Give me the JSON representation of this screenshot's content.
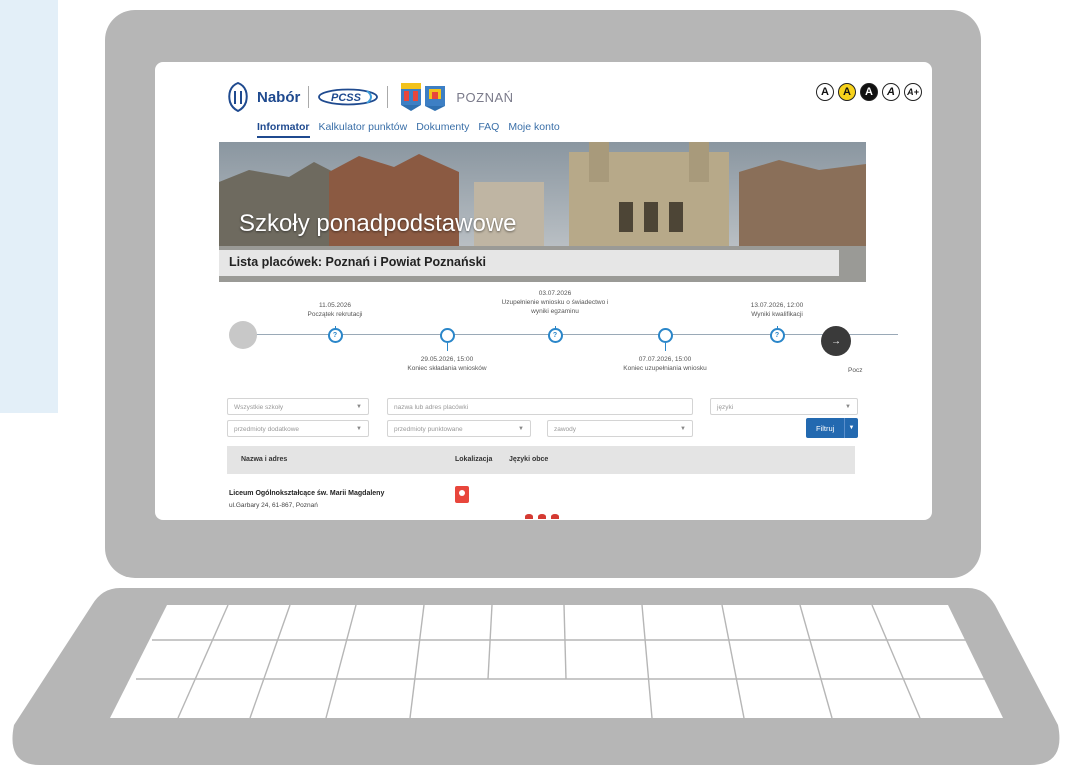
{
  "header": {
    "brand_text": "Nabór",
    "partner_text": "PCSS",
    "city": "POZNAŃ",
    "contrast_buttons": [
      "A",
      "A",
      "A",
      "A",
      "A+"
    ]
  },
  "nav": {
    "items": [
      "Informator",
      "Kalkulator punktów",
      "Dokumenty",
      "FAQ",
      "Moje konto"
    ],
    "active": "Informator"
  },
  "hero": {
    "title": "Szkoły ponadpodstawowe",
    "subtitle": "Lista placówek: Poznań i Powiat Poznański"
  },
  "timeline": {
    "items": [
      {
        "date": "11.05.2026",
        "label": "Początek rekrutacji"
      },
      {
        "date": "29.05.2026, 15:00",
        "label": "Koniec składania wniosków"
      },
      {
        "date": "03.07.2026",
        "label": "Uzupełnienie wniosku o świadectwo i wyniki egzaminu"
      },
      {
        "date": "07.07.2026, 15:00",
        "label": "Koniec uzupełniania wniosku"
      },
      {
        "date": "13.07.2026, 12:00",
        "label": "Wyniki kwalifikacji"
      }
    ],
    "node_symbol": "?",
    "next_symbol": "→",
    "overflow_text": "Pocz"
  },
  "filters": {
    "all_schools": "Wszystkie szkoły",
    "search_placeholder": "nazwa lub adres placówki",
    "languages": "języki",
    "extra_subjects": "przedmioty dodatkowe",
    "scored_subjects": "przedmioty punktowane",
    "professions": "zawody",
    "filter_button": "Filtruj"
  },
  "table": {
    "columns": [
      "Nazwa i adres",
      "Lokalizacja",
      "Języki obce"
    ],
    "rows": [
      {
        "name": "Liceum Ogólnokształcące św. Marii Magdaleny",
        "address": "ul.Garbary 24, 61-867, Poznań"
      }
    ]
  },
  "colors": {
    "laptop": "#b6b6b6",
    "accent": "#2369b0",
    "brand": "#1f4a8f",
    "side_panel": "#e3eff8"
  }
}
